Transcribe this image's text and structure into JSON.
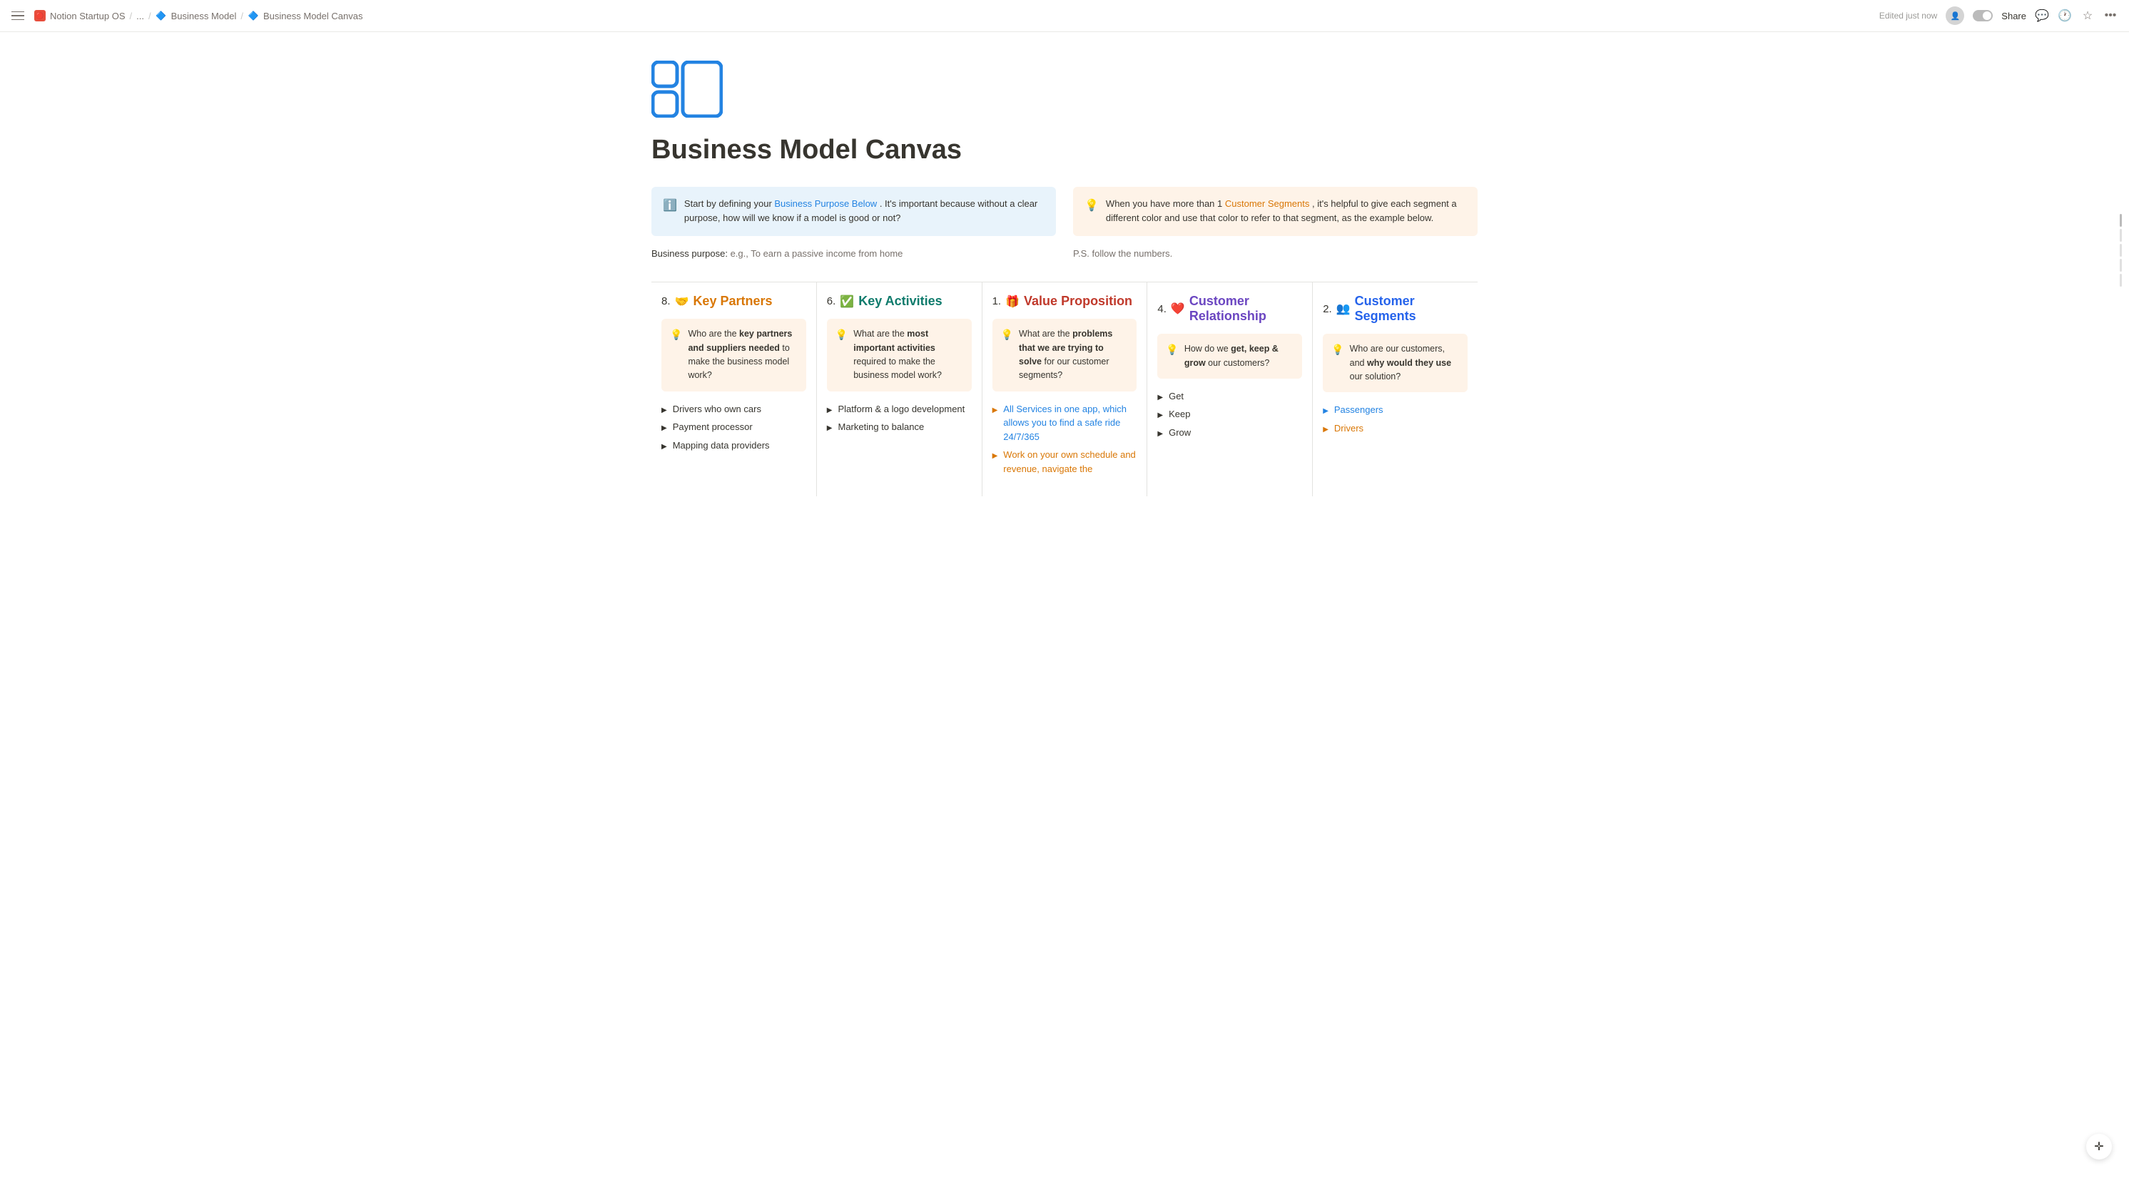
{
  "topbar": {
    "menu_label": "menu",
    "site_icon": "🔴",
    "site_name": "Notion Startup OS",
    "sep1": "/",
    "breadcrumb_ellipsis": "...",
    "sep2": "/",
    "page1_icon": "🔷",
    "page1_name": "Business Model",
    "sep3": "/",
    "page2_icon": "🔷",
    "page2_name": "Business Model Canvas",
    "edited_label": "Edited just now",
    "share_label": "Share"
  },
  "page": {
    "title": "Business Model Canvas",
    "info_blue": {
      "text_before": "Start by defining your ",
      "link": "Business Purpose Below",
      "text_after": ". It's important because without a clear purpose, how will we know if a model is good or not?"
    },
    "info_orange": {
      "text_before": "When you have more than 1 ",
      "link": "Customer Segments",
      "text_after": ", it's helpful to give each segment a different color and use that color to refer to that segment, as the example below."
    },
    "business_purpose_label": "Business purpose:",
    "business_purpose_example": "e.g., To earn a passive income from home",
    "ps_text": "P.S. follow the numbers."
  },
  "canvas": {
    "columns": [
      {
        "number": "8.",
        "emoji": "🤝",
        "title": "Key Partners",
        "title_class": "col-title-orange",
        "prompt": {
          "text_before": "Who are the ",
          "bold1": "key partners and suppliers needed",
          "text_after": " to make the business model work?"
        },
        "list_items": [
          {
            "text": "Drivers who own cars",
            "color": "normal"
          },
          {
            "text": "Payment processor",
            "color": "normal"
          },
          {
            "text": "Mapping data providers",
            "color": "normal"
          }
        ]
      },
      {
        "number": "6.",
        "emoji": "✅",
        "title": "Key Activities",
        "title_class": "col-title-green",
        "prompt": {
          "text_before": "What are the ",
          "bold1": "most important activities",
          "text_after": " required to make the business model work?"
        },
        "list_items": [
          {
            "text": "Platform & a logo development",
            "color": "normal"
          },
          {
            "text": "Marketing to balance",
            "color": "normal"
          }
        ]
      },
      {
        "number": "1.",
        "emoji": "🎁",
        "title": "Value Proposition",
        "title_class": "col-title-red",
        "prompt": {
          "text_before": "What are the ",
          "bold1": "problems that we are trying to solve",
          "text_after": " for our customer segments?"
        },
        "list_items": [
          {
            "text": "All Services in one app, which allows you to find a safe ride 24/7/365",
            "color": "blue"
          },
          {
            "text": "Work on your own schedule and revenue, navigate the",
            "color": "orange"
          }
        ]
      },
      {
        "number": "4.",
        "emoji": "❤️",
        "title": "Customer Relationship",
        "title_class": "col-title-purple",
        "prompt": {
          "text_before": "How do we ",
          "bold1": "get, keep & grow",
          "text_after": " our customers?"
        },
        "list_items": [
          {
            "text": "Get",
            "color": "normal"
          },
          {
            "text": "Keep",
            "color": "normal"
          },
          {
            "text": "Grow",
            "color": "normal"
          }
        ]
      },
      {
        "number": "2.",
        "emoji": "👥",
        "title": "Customer Segments",
        "title_class": "col-title-blue",
        "prompt": {
          "text_before": "Who are our customers, and ",
          "bold1": "why would they use",
          "text_after": " our solution?"
        },
        "list_items": [
          {
            "text": "Passengers",
            "color": "blue"
          },
          {
            "text": "Drivers",
            "color": "orange"
          }
        ]
      }
    ]
  }
}
